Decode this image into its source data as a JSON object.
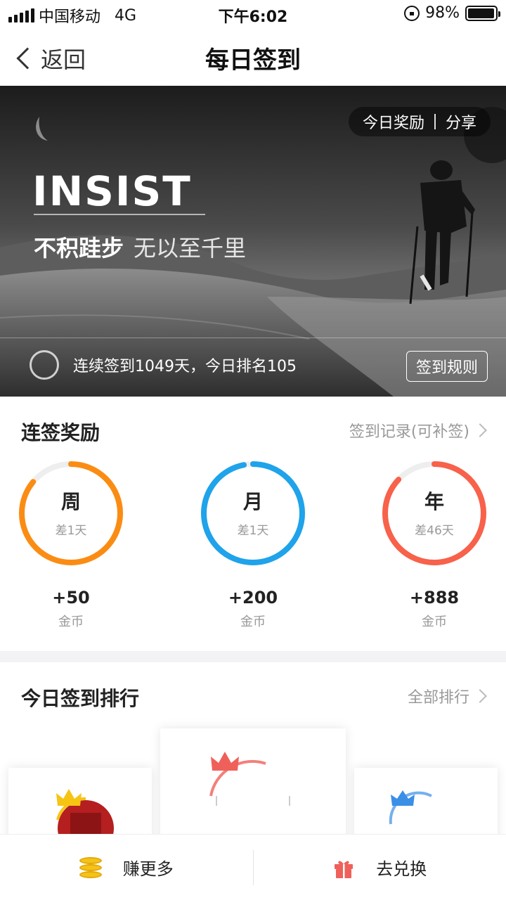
{
  "status_bar": {
    "carrier": "中国移动",
    "network": "4G",
    "time": "下午6:02",
    "battery": "98%",
    "battery_level": 0.98
  },
  "nav": {
    "back_label": "返回",
    "title": "每日签到"
  },
  "banner": {
    "chip_left": "今日奖励",
    "chip_right": "分享",
    "headline": "INSIST",
    "motto_bold": "不积跬步",
    "motto_light": "无以至千里",
    "checkin_text": "连续签到1049天，今日排名105",
    "rules_button": "签到规则"
  },
  "streak": {
    "title": "连签奖励",
    "link": "签到记录(可补签)",
    "rewards": [
      {
        "period": "周",
        "remaining": "差1天",
        "amount": "+50",
        "unit": "金币",
        "color": "#fb8c13",
        "progress": 0.86
      },
      {
        "period": "月",
        "remaining": "差1天",
        "amount": "+200",
        "unit": "金币",
        "color": "#1fa3ea",
        "progress": 0.97
      },
      {
        "period": "年",
        "remaining": "差46天",
        "amount": "+888",
        "unit": "金币",
        "color": "#f8614a",
        "progress": 0.87
      }
    ]
  },
  "ranking": {
    "title": "今日签到排行",
    "link": "全部排行",
    "crown_colors": [
      "#f6c412",
      "#f0605a",
      "#3a8fe6"
    ]
  },
  "bottom": {
    "earn_label": "赚更多",
    "exchange_label": "去兑换"
  }
}
